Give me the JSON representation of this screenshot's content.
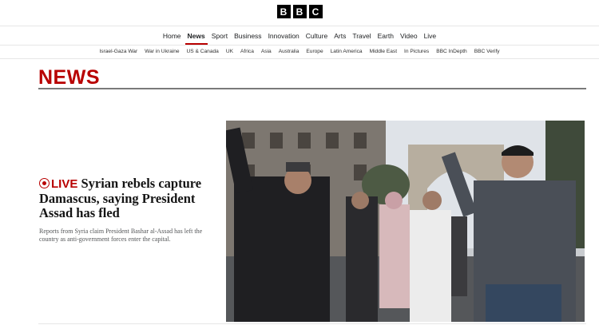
{
  "logo": {
    "letters": [
      "B",
      "B",
      "C"
    ]
  },
  "nav": {
    "items": [
      "Home",
      "News",
      "Sport",
      "Business",
      "Innovation",
      "Culture",
      "Arts",
      "Travel",
      "Earth",
      "Video",
      "Live"
    ],
    "active": "News"
  },
  "subnav": {
    "items": [
      "Israel-Gaza War",
      "War in Ukraine",
      "US & Canada",
      "UK",
      "Africa",
      "Asia",
      "Australia",
      "Europe",
      "Latin America",
      "Middle East",
      "In Pictures",
      "BBC InDepth",
      "BBC Verify"
    ]
  },
  "masthead": {
    "title": "NEWS"
  },
  "story": {
    "live_label": "LIVE",
    "headline": "Syrian rebels capture Damascus, saying President Assad has fled",
    "summary": "Reports from Syria claim President Bashar al-Assad has left the country as anti-government forces enter the capital."
  },
  "colors": {
    "brand_red": "#b80000",
    "logo_black": "#000000"
  }
}
